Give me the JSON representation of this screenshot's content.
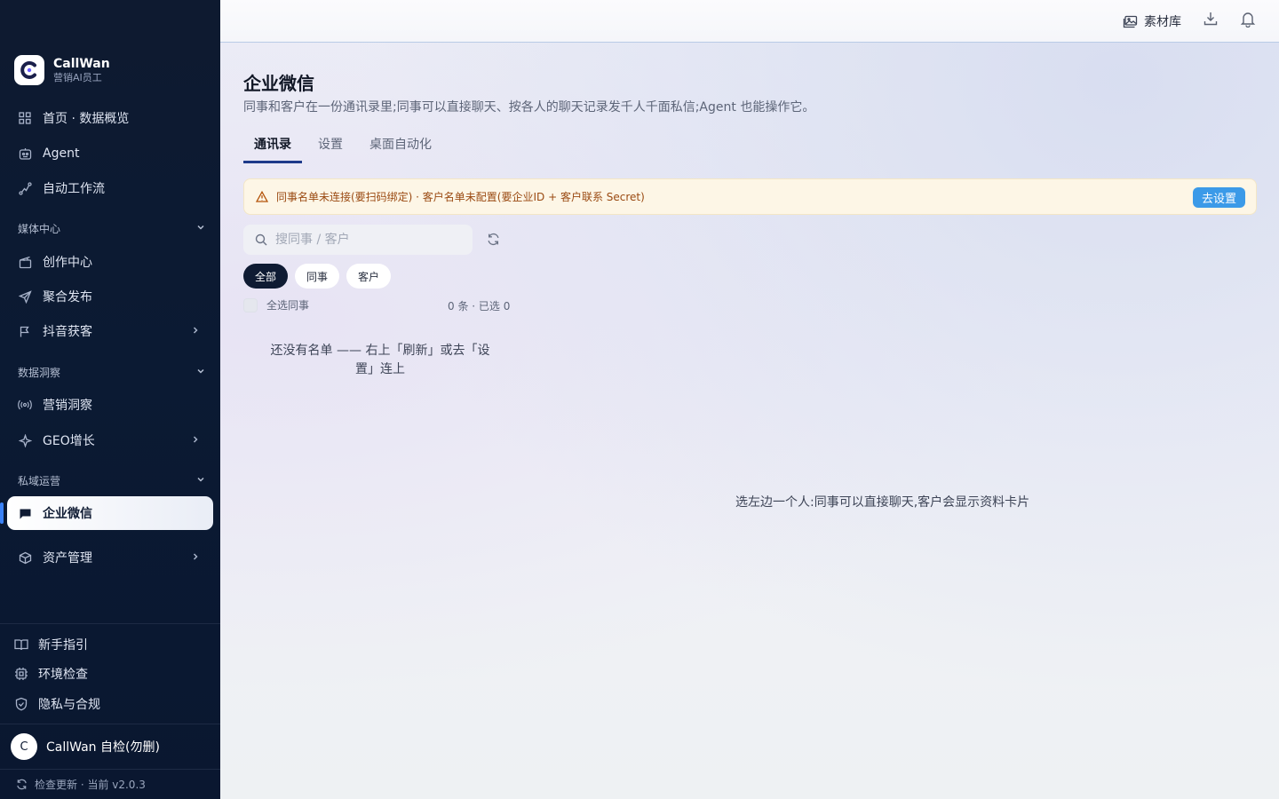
{
  "brand": {
    "name": "CallWan",
    "subtitle": "营销AI员工",
    "logo_letter": "C"
  },
  "sidebar": {
    "top_items": [
      {
        "label": "首页 · 数据概览",
        "icon": "grid-icon"
      },
      {
        "label": "Agent",
        "icon": "robot-icon"
      },
      {
        "label": "自动工作流",
        "icon": "workflow-icon"
      }
    ],
    "sections": [
      {
        "label": "媒体中心",
        "items": [
          {
            "label": "创作中心",
            "icon": "clapperboard-icon"
          },
          {
            "label": "聚合发布",
            "icon": "send-icon"
          },
          {
            "label": "抖音获客",
            "icon": "flag-icon",
            "has_submenu": true
          }
        ]
      },
      {
        "label": "数据洞察",
        "items": [
          {
            "label": "营销洞察",
            "icon": "radio-icon"
          },
          {
            "label": "GEO增长",
            "icon": "sparkle-icon",
            "has_submenu": true
          }
        ]
      },
      {
        "label": "私域运营",
        "items": [
          {
            "label": "企业微信",
            "icon": "chat-icon",
            "active": true
          },
          {
            "label": "资产管理",
            "icon": "box-icon",
            "has_submenu": true
          }
        ]
      }
    ],
    "footer_items": [
      {
        "label": "新手指引",
        "icon": "book-icon"
      },
      {
        "label": "环境检查",
        "icon": "cpu-icon"
      },
      {
        "label": "隐私与合规",
        "icon": "shield-icon"
      }
    ],
    "user": {
      "avatar_letter": "C",
      "name": "CallWan 自检(勿删)"
    },
    "update": {
      "label": "检查更新 · 当前 v2.0.3"
    }
  },
  "topbar": {
    "library_label": "素材库",
    "icons": [
      "image-icon",
      "download-icon",
      "bell-icon"
    ]
  },
  "page": {
    "title": "企业微信",
    "description": "同事和客户在一份通讯录里;同事可以直接聊天、按各人的聊天记录发千人千面私信;Agent 也能操作它。",
    "tabs": [
      {
        "label": "通讯录",
        "active": true
      },
      {
        "label": "设置",
        "active": false
      },
      {
        "label": "桌面自动化",
        "active": false
      }
    ],
    "alert": {
      "text": "同事名单未连接(要扫码绑定) · 客户名单未配置(要企业ID + 客户联系 Secret)",
      "button_label": "去设置"
    },
    "search": {
      "placeholder": "搜同事 / 客户",
      "value": ""
    },
    "filters": [
      {
        "label": "全部",
        "active": true
      },
      {
        "label": "同事",
        "active": false
      },
      {
        "label": "客户",
        "active": false
      }
    ],
    "select_all_label": "全选同事",
    "count_label": "0 条 · 已选 0",
    "empty_list_text": "还没有名单 —— 右上「刷新」或去「设置」连上",
    "detail_hint": "选左边一个人:同事可以直接聊天,客户会显示资料卡片"
  },
  "colors": {
    "sidebar_bg": "#0b1a33",
    "accent": "#3b9ae8",
    "alert_bg": "#fdf6e6",
    "alert_text": "#9a4a12",
    "chip_active_bg": "#0f1b33",
    "active_marker": "#3b82f6"
  }
}
